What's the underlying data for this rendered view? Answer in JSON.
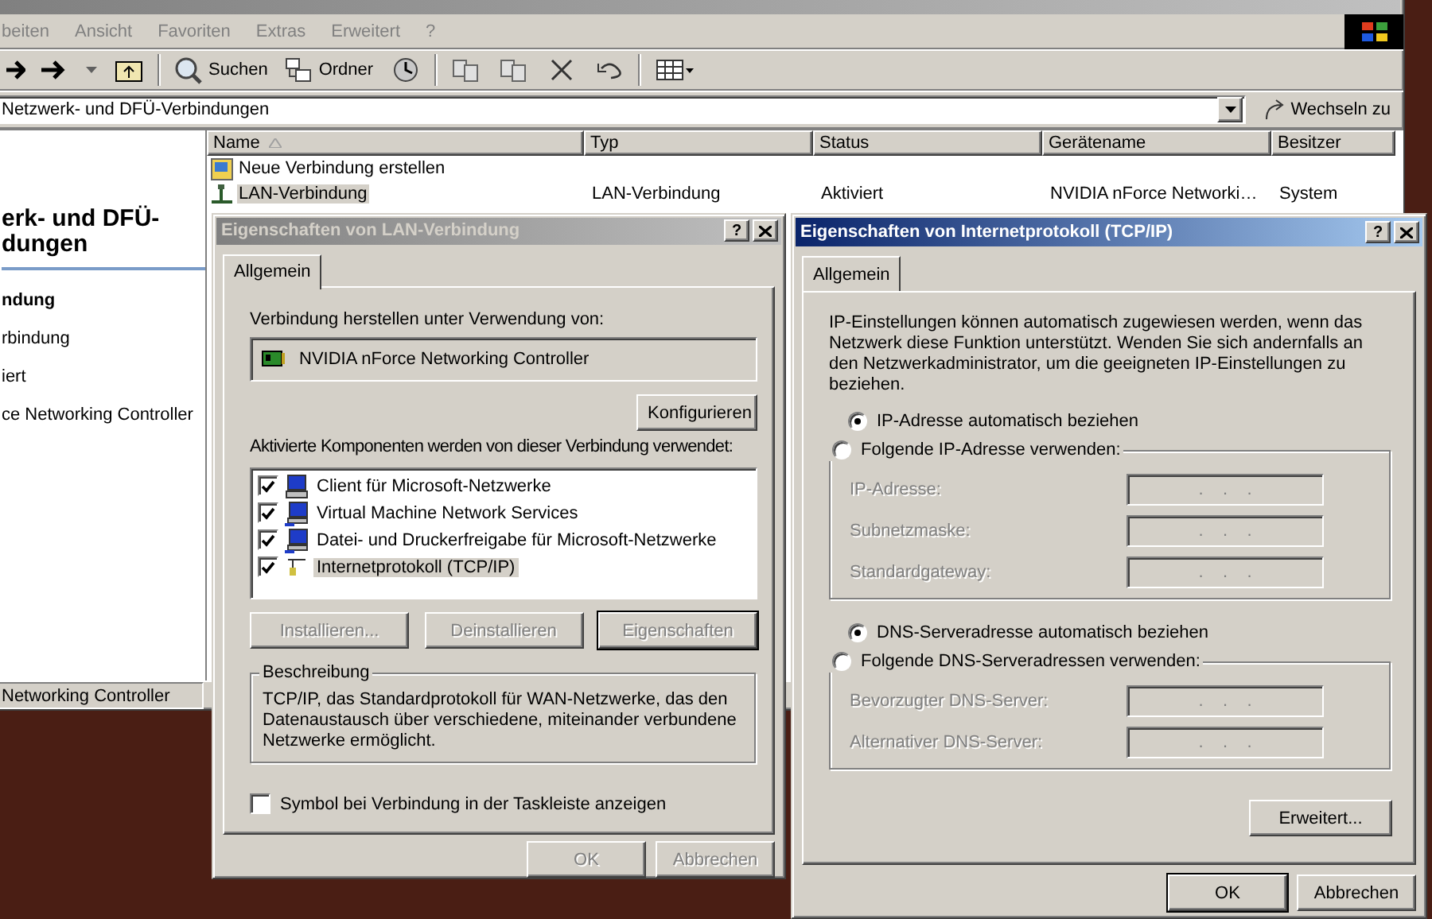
{
  "explorer": {
    "active": false,
    "menu": [
      "beiten",
      "Ansicht",
      "Favoriten",
      "Extras",
      "Erweitert",
      "?"
    ],
    "toolbar": [
      {
        "kind": "forward"
      },
      {
        "kind": "dropdown"
      },
      {
        "kind": "up"
      },
      {
        "kind": "search",
        "label": "Suchen"
      },
      {
        "kind": "folders",
        "label": "Ordner"
      },
      {
        "kind": "history"
      },
      {
        "kind": "move"
      },
      {
        "kind": "copy"
      },
      {
        "kind": "delete"
      },
      {
        "kind": "undo"
      },
      {
        "kind": "views"
      }
    ],
    "address": {
      "value": "Netzwerk- und DFÜ-Verbindungen",
      "go_button": "Wechseln zu"
    },
    "sidebar": {
      "heading": [
        "erk- und DFÜ-",
        "dungen"
      ],
      "details": [
        {
          "text": "ndung",
          "bold": true
        },
        {
          "text": "rbindung",
          "bold": false
        },
        {
          "text": "iert",
          "bold": false
        },
        {
          "text": "ce Networking Controller",
          "bold": false
        }
      ]
    },
    "list": {
      "columns": [
        {
          "label": "Name",
          "sorted": true
        },
        {
          "label": "Typ",
          "sorted": false
        },
        {
          "label": "Status",
          "sorted": false
        },
        {
          "label": "Gerätename",
          "sorted": false
        },
        {
          "label": "Besitzer",
          "sorted": false
        }
      ],
      "rows": [
        {
          "kind": "wizard",
          "selected": false,
          "cells": [
            "Neue Verbindung erstellen"
          ]
        },
        {
          "kind": "lan",
          "selected": true,
          "cells": [
            "LAN-Verbindung",
            "LAN-Verbindung",
            "Aktiviert",
            "NVIDIA nForce Networki…",
            "System"
          ]
        }
      ]
    },
    "status_bar": "Networking Controller"
  },
  "lan_dialog": {
    "title": "Eigenschaften von LAN-Verbindung",
    "active": false,
    "help_button": "?",
    "tabs": [
      {
        "label": "Allgemein",
        "selected": true
      }
    ],
    "connect_using_label": "Verbindung herstellen unter Verwendung von:",
    "adapter": "NVIDIA nForce Networking Controller",
    "configure_button": "Konfigurieren",
    "components_label": "Aktivierte Komponenten werden von dieser Verbindung verwendet:",
    "components": [
      {
        "kind": "client",
        "label": "Client für Microsoft-Netzwerke",
        "checked": true,
        "selected": false
      },
      {
        "kind": "service",
        "label": "Virtual Machine Network Services",
        "checked": true,
        "selected": false
      },
      {
        "kind": "service",
        "label": "Datei- und Druckerfreigabe für Microsoft-Netzwerke",
        "checked": true,
        "selected": false
      },
      {
        "kind": "protocol",
        "label": "Internetprotokoll (TCP/IP)",
        "checked": true,
        "selected": true
      }
    ],
    "component_buttons": [
      {
        "label": "Installieren...",
        "disabled": true,
        "default": false
      },
      {
        "label": "Deinstallieren",
        "disabled": true,
        "default": false
      },
      {
        "label": "Eigenschaften",
        "disabled": true,
        "default": true
      }
    ],
    "description": {
      "title": "Beschreibung",
      "text": "TCP/IP, das Standardprotokoll für WAN-Netzwerke, das den Datenaustausch über verschiedene, miteinander verbundene Netzwerke ermöglicht."
    },
    "tray_checkbox": {
      "label": "Symbol bei Verbindung in der Taskleiste anzeigen",
      "checked": false
    },
    "buttons": [
      {
        "label": "OK",
        "disabled": true,
        "default": false
      },
      {
        "label": "Abbrechen",
        "disabled": true,
        "default": false
      }
    ]
  },
  "tcp_dialog": {
    "title": "Eigenschaften von Internetprotokoll (TCP/IP)",
    "active": true,
    "help_button": "?",
    "tabs": [
      {
        "label": "Allgemein",
        "selected": true
      }
    ],
    "intro": "IP-Einstellungen können automatisch zugewiesen werden, wenn das Netzwerk diese Funktion unterstützt. Wenden Sie sich andernfalls an den Netzwerkadministrator, um die geeigneten IP-Einstellungen zu beziehen.",
    "ip_options": [
      {
        "kind": "plain",
        "label": "IP-Adresse automatisch beziehen",
        "selected": true
      },
      {
        "kind": "group",
        "label": "Folgende IP-Adresse verwenden:",
        "selected": false,
        "fields": [
          {
            "label": "IP-Adresse:",
            "disabled": true,
            "value": ".    .    ."
          },
          {
            "label": "Subnetzmaske:",
            "disabled": true,
            "value": ".    .    ."
          },
          {
            "label": "Standardgateway:",
            "disabled": true,
            "value": ".    .    ."
          }
        ]
      }
    ],
    "dns_options": [
      {
        "kind": "plain",
        "label": "DNS-Serveradresse automatisch beziehen",
        "selected": true
      },
      {
        "kind": "group",
        "label": "Folgende DNS-Serveradressen verwenden:",
        "selected": false,
        "fields": [
          {
            "label": "Bevorzugter DNS-Server:",
            "disabled": true,
            "value": ".    .    ."
          },
          {
            "label": "Alternativer DNS-Server:",
            "disabled": true,
            "value": ".    .    ."
          }
        ]
      }
    ],
    "advanced_button": {
      "label": "Erweitert...",
      "disabled": false,
      "default": false
    },
    "buttons": [
      {
        "label": "OK",
        "disabled": false,
        "default": true
      },
      {
        "label": "Abbrechen",
        "disabled": false,
        "default": false
      }
    ]
  }
}
